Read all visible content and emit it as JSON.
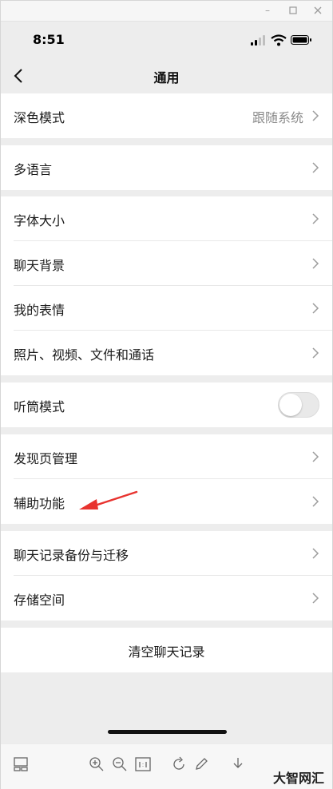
{
  "status_bar": {
    "time": "8:51"
  },
  "nav": {
    "title": "通用"
  },
  "settings": {
    "dark_mode": {
      "label": "深色模式",
      "value": "跟随系统"
    },
    "language": {
      "label": "多语言"
    },
    "font_size": {
      "label": "字体大小"
    },
    "chat_background": {
      "label": "聊天背景"
    },
    "my_stickers": {
      "label": "我的表情"
    },
    "media_files": {
      "label": "照片、视频、文件和通话"
    },
    "earpiece_mode": {
      "label": "听筒模式",
      "enabled": false
    },
    "discover_management": {
      "label": "发现页管理"
    },
    "accessibility": {
      "label": "辅助功能"
    },
    "chat_backup": {
      "label": "聊天记录备份与迁移"
    },
    "storage": {
      "label": "存储空间"
    },
    "clear_history": {
      "label": "清空聊天记录"
    }
  },
  "watermark": {
    "text": "大智网汇"
  },
  "colors": {
    "background": "#ededed",
    "annotation_arrow": "#e8332f"
  }
}
